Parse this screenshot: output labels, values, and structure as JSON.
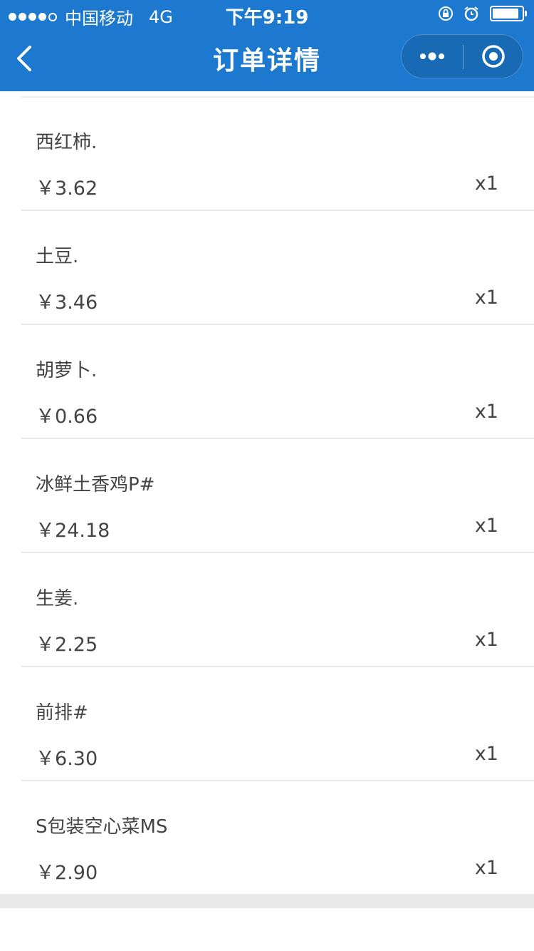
{
  "status_bar": {
    "carrier": "中国移动",
    "network": "4G",
    "time": "下午9:19"
  },
  "nav": {
    "title": "订单详情"
  },
  "items": [
    {
      "name": "西红柿.",
      "price": "￥3.62",
      "qty": "x1"
    },
    {
      "name": "土豆.",
      "price": "￥3.46",
      "qty": "x1"
    },
    {
      "name": "胡萝卜.",
      "price": "￥0.66",
      "qty": "x1"
    },
    {
      "name": "冰鲜土香鸡P#",
      "price": "￥24.18",
      "qty": "x1"
    },
    {
      "name": "生姜.",
      "price": "￥2.25",
      "qty": "x1"
    },
    {
      "name": "前排#",
      "price": "￥6.30",
      "qty": "x1"
    },
    {
      "name": "S包装空心菜MS",
      "price": "￥2.90",
      "qty": "x1"
    }
  ],
  "colors": {
    "header": "#1c79cf",
    "text": "#444444",
    "divider": "#e8e8e8"
  },
  "icons": [
    "back-arrow-icon",
    "more-dots-icon",
    "close-circle-icon",
    "orientation-lock-icon",
    "alarm-icon",
    "battery-icon"
  ]
}
